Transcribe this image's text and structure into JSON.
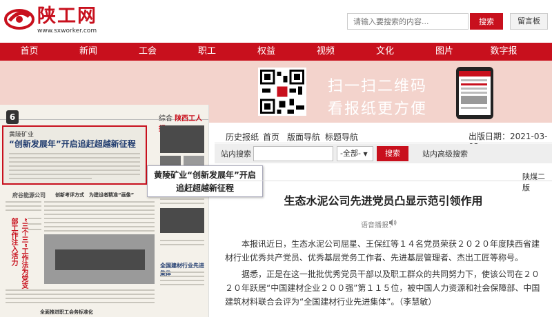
{
  "header": {
    "logo_text": "陕工网",
    "logo_url": "www.sxworker.com",
    "search_placeholder": "请输入要搜索的内容...",
    "search_button": "搜索",
    "message_button": "留言板"
  },
  "nav": {
    "items": [
      "首页",
      "新闻",
      "工会",
      "职工",
      "权益",
      "视频",
      "文化",
      "图片",
      "数字报"
    ]
  },
  "banner": {
    "line1": "扫一扫二维码",
    "line2": "看报纸更方便"
  },
  "paper": {
    "page_number": "6",
    "section_label": "综合",
    "section_brand": "陕西工人报",
    "headline_kicker": "黄陵矿业",
    "headline": "“创新发展年”开启追赶超越新征程",
    "story2_left": "府谷能源公司",
    "story2_mid": "创新考评方式　为建设者精准“画像”",
    "story3_vertical": "“三个三”工作法为党支部工作注入活力",
    "story4_right": "全国建材行业先进集体",
    "story5_bottom": "全面推进职工会务标准化"
  },
  "tooltip": {
    "text": "黄陵矿业“创新发展年”开启追赶超越新征程"
  },
  "toolbar": {
    "items": [
      "历史报纸",
      "首页",
      "版面导航",
      "标题导航"
    ],
    "date_label": "出版日期：2021-03-02"
  },
  "site_search": {
    "label": "站内搜索",
    "select_value": "-全部-",
    "button": "搜索",
    "advanced": "站内高级搜索"
  },
  "article": {
    "edition": "陕煤二版",
    "title": "生态水泥公司先进党员凸显示范引领作用",
    "audio_label": "语音播报：",
    "paragraphs": [
      "本报讯近日，生态水泥公司屈星、王保红等１４名党员荣获２０２０年度陕西省建材行业优秀共产党员、优秀基层党务工作者、先进基层管理者、杰出工匠等称号。",
      "据悉，正是在这一批批优秀党员干部以及职工群众的共同努力下，使该公司在２０２０年跃居“中国建材企业２００强”第１１５位，被中国人力资源和社会保障部、中国建筑材料联合会评为“全国建材行业先进集体”。（李慧敏）"
    ]
  },
  "colors": {
    "brand_red": "#c8101d",
    "band_pink": "#f3d3cc"
  }
}
